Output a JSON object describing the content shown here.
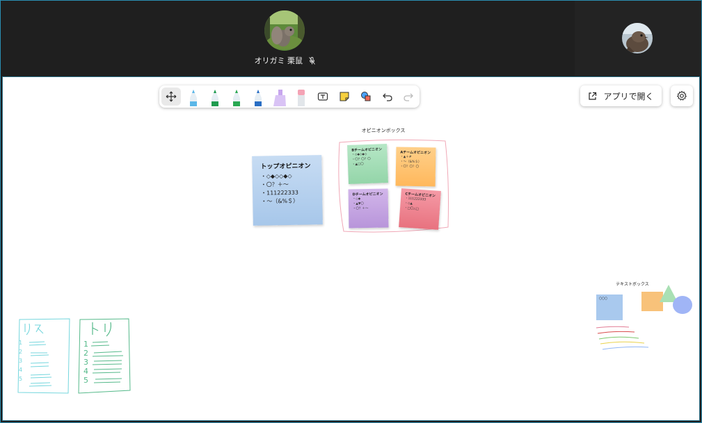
{
  "participants": [
    {
      "name": "オリガミ 栗鼠",
      "muted": true,
      "avatar": "squirrel-photo"
    },
    {
      "name": "",
      "avatar": "bird-photo"
    }
  ],
  "toolbar": {
    "tools": [
      {
        "name": "move-tool",
        "icon": "move-arrows-icon",
        "active": true
      },
      {
        "name": "pen-light-blue",
        "color": "#5bb7e8"
      },
      {
        "name": "pen-green",
        "color": "#1f9b4f"
      },
      {
        "name": "pen-green-2",
        "color": "#2aa852"
      },
      {
        "name": "pen-blue",
        "color": "#2a6fc4"
      },
      {
        "name": "highlighter-purple",
        "color": "#c7a6ee"
      },
      {
        "name": "eraser",
        "color": "#f4a3b5"
      },
      {
        "name": "text-tool",
        "icon": "text-box-icon"
      },
      {
        "name": "sticky-note-tool",
        "icon": "sticky-note-icon"
      },
      {
        "name": "shapes-tool",
        "icon": "shapes-icon"
      },
      {
        "name": "undo",
        "icon": "undo-icon"
      },
      {
        "name": "redo",
        "icon": "redo-icon",
        "disabled": true
      }
    ]
  },
  "open_in_app": {
    "label": "アプリで開く",
    "icon": "external-link-icon"
  },
  "settings": {
    "icon": "gear-icon"
  },
  "canvas": {
    "top_opinion_note": {
      "title": "トップオピニオン",
      "lines": [
        "・◇◆◇◇◆◇",
        "・〇？＋～",
        "・111222333",
        "・～（&%＄）"
      ],
      "color": "#b7d2f0"
    },
    "opinion_box": {
      "title": "オピニオンボックス",
      "notes": [
        {
          "title": "Bチームオピニオン",
          "lines": [
            "・◇◆◇◆◇",
            "・〇？〇？〇",
            "・▲□〇"
          ],
          "color": "#a3dcb5"
        },
        {
          "title": "Aチームオピニオン",
          "lines": [
            "・▲＋#",
            "・～（&%＄）",
            "・〇？〇？〇"
          ],
          "color": "#ffc26e"
        },
        {
          "title": "Dチームオピニオン",
          "lines": [
            "・◇◆",
            "・▲▼〇",
            "・〇？＋～"
          ],
          "color": "#c6a8e0"
        },
        {
          "title": "Cチームオピニオン",
          "lines": [
            "・111222333",
            "・◇▲",
            "・□〇△□"
          ],
          "color": "#f0808f"
        }
      ]
    },
    "text_box_area": {
      "title": "テキストボックス",
      "note_text": "〇〇〇"
    },
    "handwriting": [
      {
        "heading": "リス",
        "numbers": [
          "1",
          "2",
          "3",
          "4",
          "5"
        ],
        "color": "#74d6dd"
      },
      {
        "heading": "トリ",
        "numbers": [
          "1",
          "2",
          "3",
          "4",
          "5"
        ],
        "color": "#55b98a"
      }
    ]
  }
}
